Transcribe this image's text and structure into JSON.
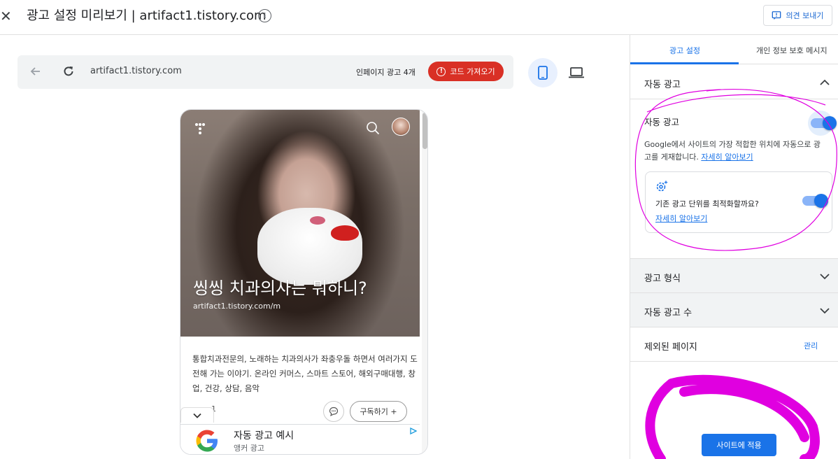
{
  "header": {
    "title": "광고 설정 미리보기 | artifact1.tistory.com",
    "feedback_label": "의견 보내기"
  },
  "preview_bar": {
    "url": "artifact1.tistory.com",
    "inpage_ads": "인페이지 광고 4개",
    "get_code_label": "코드 가져오기"
  },
  "phone": {
    "hero_title": "씽씽 치과의사는 뭐하니?",
    "hero_url": "artifact1.tistory.com/m",
    "description": "통합치과전문의, 노래하는 치과의사가 좌충우돌 하면서 여러가지 도전해 가는 이야기. 온라인 커머스, 스마트 스토어, 해외구매대행, 창업, 건강, 상담, 음악",
    "post_count": "1",
    "subscribe_label": "구독하기 +",
    "ad_title": "자동 광고 예시",
    "ad_subtitle": "앵커 광고"
  },
  "panel": {
    "tabs": [
      {
        "label": "광고 설정"
      },
      {
        "label": "개인 정보 보호 메시지"
      }
    ],
    "auto_ads": {
      "section_label": "자동 광고",
      "toggle_label": "자동 광고",
      "toggle_on": true,
      "desc": "Google에서 사이트의 가장 적합한 위치에 자동으로 광고를 게재합니다.",
      "learn_more": "자세히 알아보기",
      "optimize_question": "기존 광고 단위를 최적화할까요?",
      "optimize_on": true,
      "optimize_learn_more": "자세히 알아보기"
    },
    "ad_formats_label": "광고 형식",
    "ad_load_label": "자동 광고 수",
    "excluded_pages_label": "제외된 페이지",
    "manage_label": "관리",
    "apply_label": "사이트에 적용"
  },
  "colors": {
    "accent": "#1a73e8",
    "danger": "#d93025",
    "annotation": "#e000e0"
  }
}
